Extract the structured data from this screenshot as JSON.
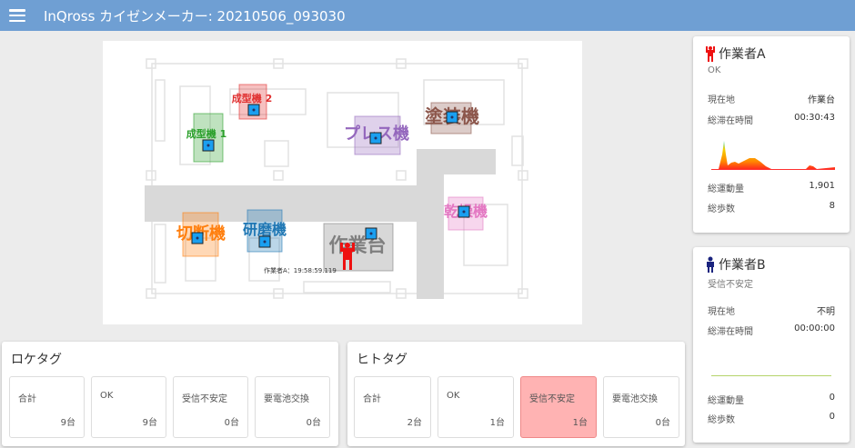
{
  "header": {
    "title": "InQross カイゼンメーカー: 20210506_093030",
    "menu_icon": "hamburger-icon"
  },
  "map": {
    "machines": [
      {
        "label": "成型機 2",
        "color": "#e03030"
      },
      {
        "label": "成型機 1",
        "color": "#2ca02c"
      },
      {
        "label": "プレス機",
        "color": "#9467bd"
      },
      {
        "label": "塗装機",
        "color": "#8c564b"
      },
      {
        "label": "乾燥機",
        "color": "#e377c2"
      },
      {
        "label": "切断機",
        "color": "#ff7f0e"
      },
      {
        "label": "研磨機",
        "color": "#1f77b4"
      },
      {
        "label": "作業台",
        "color": "#7f7f7f"
      }
    ],
    "worker_label": "作業者A：19:58:59.119",
    "tag_color": "#1a9ff0"
  },
  "loc_tags": {
    "title": "ロケタグ",
    "items": [
      {
        "label": "合計",
        "value": "9台"
      },
      {
        "label": "OK",
        "value": "9台"
      },
      {
        "label": "受信不安定",
        "value": "0台"
      },
      {
        "label": "要電池交換",
        "value": "0台"
      }
    ]
  },
  "person_tags": {
    "title": "ヒトタグ",
    "items": [
      {
        "label": "合計",
        "value": "2台"
      },
      {
        "label": "OK",
        "value": "1台"
      },
      {
        "label": "受信不安定",
        "value": "1台"
      },
      {
        "label": "要電池交換",
        "value": "0台"
      }
    ]
  },
  "workers": [
    {
      "name": "作業者A",
      "status": "OK",
      "color": "#ee1111",
      "location_label": "現在地",
      "location": "作業台",
      "stay_label": "総滞在時間",
      "stay": "00:30:43",
      "motion_label": "総運動量",
      "motion": "1,901",
      "steps_label": "総歩数",
      "steps": "8"
    },
    {
      "name": "作業者B",
      "status": "受信不安定",
      "color": "#1a237e",
      "location_label": "現在地",
      "location": "不明",
      "stay_label": "総滞在時間",
      "stay": "00:00:00",
      "motion_label": "総運動量",
      "motion": "0",
      "steps_label": "総歩数",
      "steps": "0"
    }
  ]
}
